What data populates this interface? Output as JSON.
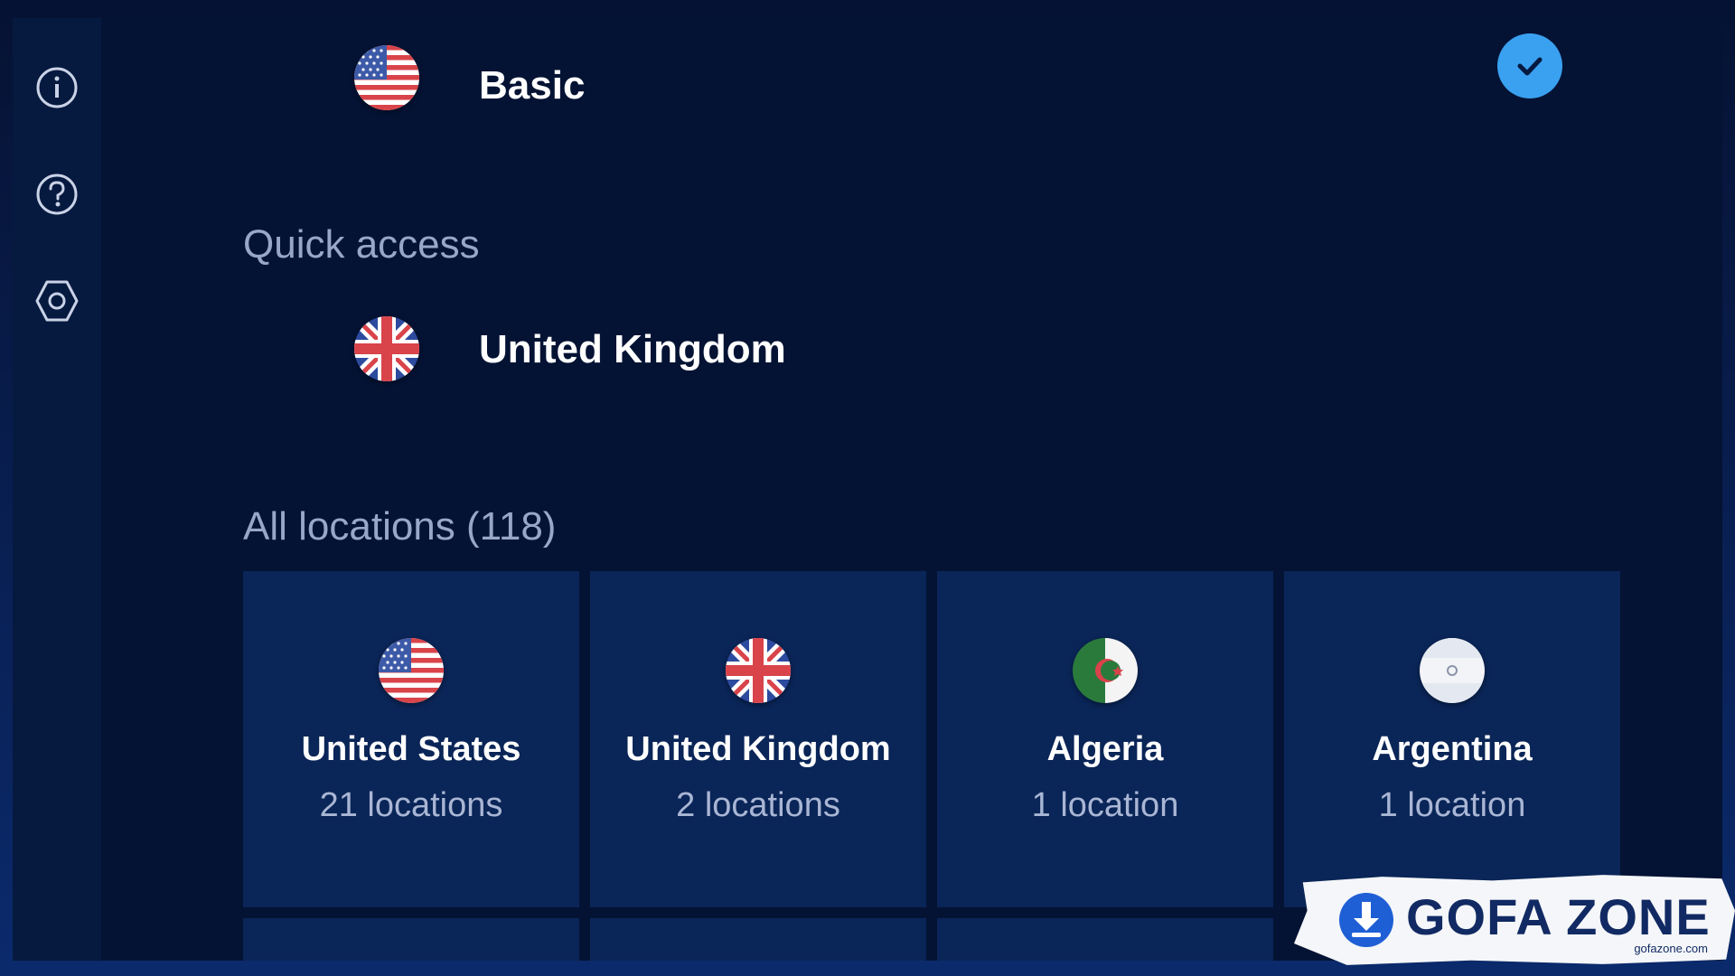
{
  "profile": {
    "label": "Basic",
    "flag": "us-flag-icon",
    "selected_icon": "check-icon"
  },
  "sidebar": {
    "items": [
      {
        "icon": "info-icon"
      },
      {
        "icon": "help-icon"
      },
      {
        "icon": "settings-icon"
      }
    ]
  },
  "quick_access": {
    "title": "Quick access",
    "items": [
      {
        "name": "United Kingdom",
        "flag": "uk-flag-icon"
      }
    ]
  },
  "all_locations": {
    "title": "All locations (118)",
    "cards": [
      {
        "name": "United States",
        "count": "21 locations",
        "flag": "us-flag-icon"
      },
      {
        "name": "United Kingdom",
        "count": "2 locations",
        "flag": "uk-flag-icon"
      },
      {
        "name": "Algeria",
        "count": "1 location",
        "flag": "dz-flag-icon"
      },
      {
        "name": "Argentina",
        "count": "1 location",
        "flag": "ar-flag-icon"
      }
    ]
  },
  "watermark": {
    "brand": "GOFA ZONE",
    "site": "gofazone.com"
  },
  "colors": {
    "background": "#041334",
    "sidebar": "#06193f",
    "card": "#0a2557",
    "accent": "#3aa0f0",
    "muted_text": "#98a7c8"
  }
}
